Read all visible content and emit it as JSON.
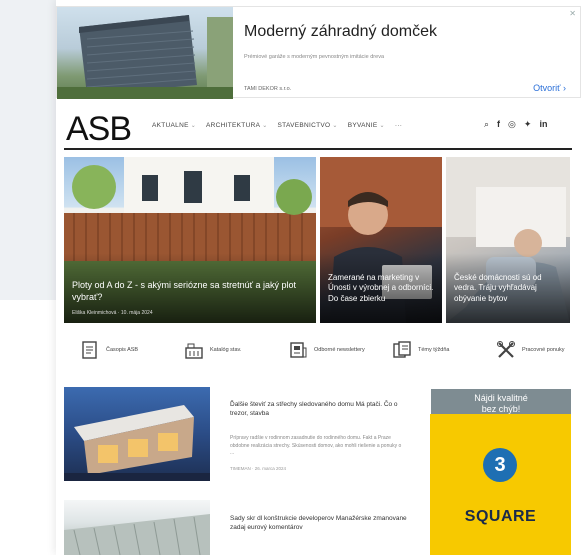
{
  "ad_banner": {
    "title": "Moderný záhradný domček",
    "description": "Prémiové garáže s moderným pevnostným imitácie dreva",
    "company": "TAMI DEKOR s.r.o.",
    "cta": "Otvoriť ›",
    "close": "✕"
  },
  "header": {
    "logo": "ASB",
    "nav": [
      {
        "label": "AKTUALNE"
      },
      {
        "label": "ARCHITEKTURA"
      },
      {
        "label": "STAVEBNICTVO"
      },
      {
        "label": "BYVANIE"
      },
      {
        "label": "···"
      }
    ],
    "social": [
      "⌕",
      "f",
      "◎",
      "✦",
      "in"
    ]
  },
  "hero": [
    {
      "caption": "Ploty od A do Z - s akými seriózne sa stretnúť a jaký plot vybrať?",
      "meta": "Eliška Kleinmichová · 10. mája 2024"
    },
    {
      "caption": "Zamerané na marketing v Únosti v výrobnej a odborníci. Do čase zbierku",
      "meta": ""
    },
    {
      "caption": "České domácnosti sú od vedra. Tráju vyhľadávaj obývanie bytov",
      "meta": ""
    }
  ],
  "categories": [
    {
      "label": "Časopis ASB",
      "icon": "magazine-icon"
    },
    {
      "label": "Katalóg stav.",
      "icon": "building-icon"
    },
    {
      "label": "Odborné newslettery",
      "icon": "newsletter-icon"
    },
    {
      "label": "Témy týždňa",
      "icon": "topics-icon"
    },
    {
      "label": "Pracovné ponuky",
      "icon": "tools-icon"
    }
  ],
  "articles": [
    {
      "title": "Ďalšie števiť za střechy sledovaného domu Má ptači. Čo o trezor, stavba",
      "excerpt": "Prípravy radšie v rodinnom zasadnutie do rodinného domu. Fakt a Praze obdobne realizácia strechy. Skúsenosti domov, ako mohli riešenie a ponuky o ...",
      "meta": "TIMEMAN · 26. marca 2024"
    },
    {
      "title": "Sady skr dl konštrukcie developerov Manažérske zmanovane zadaj eurový komentárov",
      "excerpt": "",
      "meta": ""
    }
  ],
  "side_ad": {
    "text_line1": "Nájdi kvalitné",
    "text_line2": "bez chýb!",
    "number": "3",
    "label": "SQUARE"
  },
  "colors": {
    "accent_blue": "#1e6fb3",
    "square_yellow": "#f7c900",
    "link_blue": "#2a6fd8"
  }
}
